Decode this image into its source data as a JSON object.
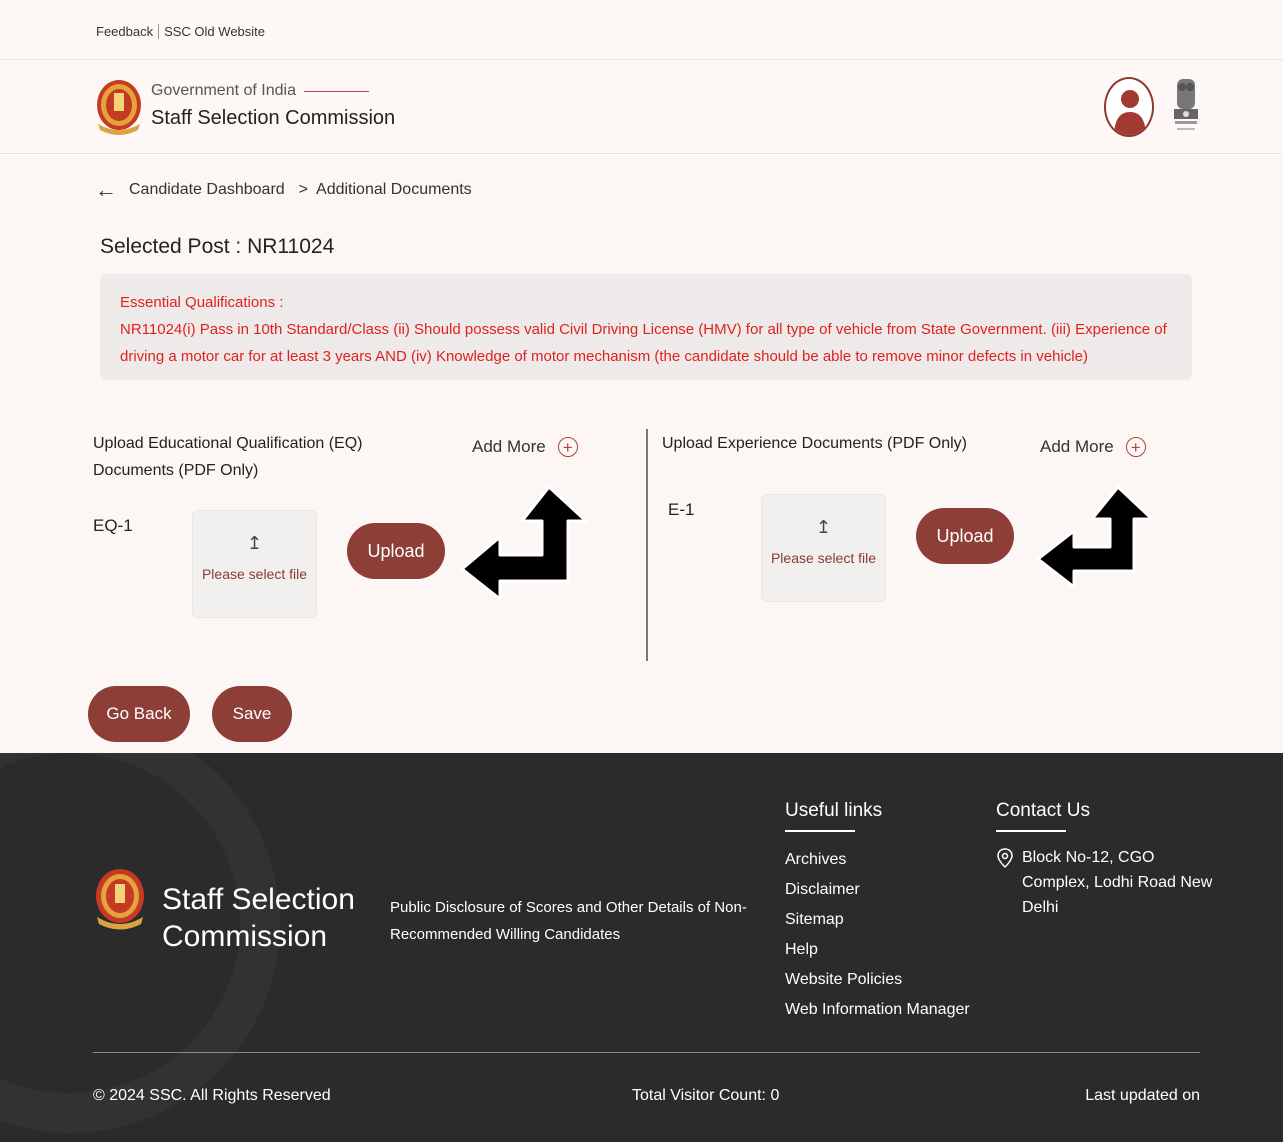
{
  "topbar": {
    "links": [
      "Feedback",
      "SSC Old Website"
    ]
  },
  "header": {
    "gov_label": "Government of India",
    "commission_name": "Staff Selection Commission"
  },
  "breadcrumb": {
    "items": [
      "Candidate Dashboard",
      "Additional Documents"
    ],
    "separator": ">"
  },
  "selected_post": "Selected Post : NR11024",
  "qualifications": {
    "heading": "Essential Qualifications :",
    "text": "NR11024(i) Pass in 10th Standard/Class (ii) Should possess valid Civil Driving License (HMV) for all type of vehicle from State Government. (iii) Experience of driving a motor car for at least 3 years AND (iv) Knowledge of motor mechanism (the candidate should be able to remove minor defects in vehicle)"
  },
  "eq_section": {
    "title": "Upload Educational Qualification (EQ) Documents (PDF Only)",
    "add_more": "Add More",
    "doc_label": "EQ-1",
    "file_placeholder": "Please select file",
    "upload_label": "Upload"
  },
  "exp_section": {
    "title": "Upload Experience Documents (PDF Only)",
    "add_more": "Add More",
    "doc_label": "E-1",
    "file_placeholder": "Please select file",
    "upload_label": "Upload"
  },
  "actions": {
    "go_back": "Go Back",
    "save": "Save"
  },
  "footer": {
    "brand": "Staff Selection Commission",
    "disclosure": "Public Disclosure of Scores and Other Details of Non-Recommended Willing Candidates",
    "useful_links_heading": "Useful links",
    "useful_links": [
      "Archives",
      "Disclaimer",
      "Sitemap",
      "Help",
      "Website Policies",
      "Web Information Manager"
    ],
    "contact_heading": "Contact Us",
    "address": "Block No-12, CGO Complex, Lodhi Road New Delhi",
    "copyright": "© 2024 SSC. All Rights Reserved",
    "visitor_count": "Total Visitor Count: 0",
    "last_updated": "Last updated on"
  },
  "colors": {
    "brand": "#8d3e37",
    "alert_text": "#e0221e",
    "footer_bg": "#2b2b2b"
  }
}
